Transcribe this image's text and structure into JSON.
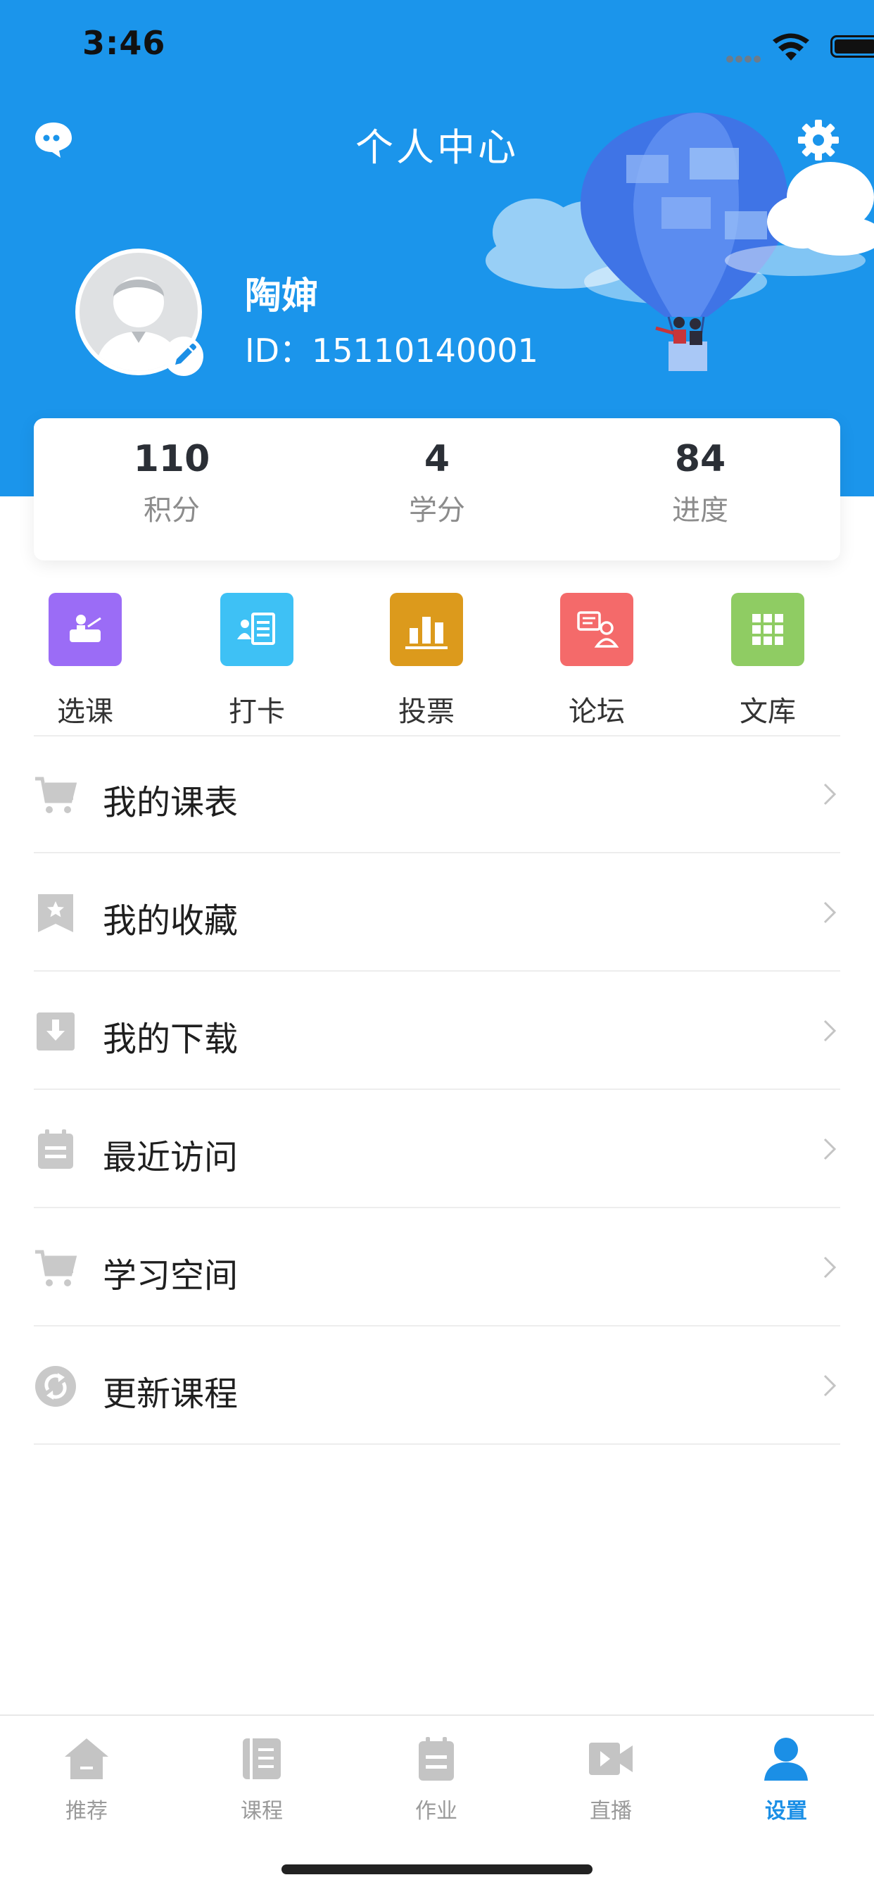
{
  "status_bar": {
    "time": "3:46"
  },
  "header": {
    "title": "个人中心"
  },
  "profile": {
    "name": "陶婶",
    "id_text": "ID：15110140001"
  },
  "stats": [
    {
      "value": "110",
      "label": "积分"
    },
    {
      "value": "4",
      "label": "学分"
    },
    {
      "value": "84",
      "label": "进度"
    }
  ],
  "quick_actions": [
    {
      "label": "选课",
      "icon": "course-select-icon",
      "color": "#9b6cf6"
    },
    {
      "label": "打卡",
      "icon": "checkin-icon",
      "color": "#3ec1f5"
    },
    {
      "label": "投票",
      "icon": "vote-icon",
      "color": "#dc9a1c"
    },
    {
      "label": "论坛",
      "icon": "forum-icon",
      "color": "#f46a6a"
    },
    {
      "label": "文库",
      "icon": "library-icon",
      "color": "#8fcc63"
    }
  ],
  "menu": [
    {
      "label": "我的课表",
      "icon": "cart-icon"
    },
    {
      "label": "我的收藏",
      "icon": "bookmark-star-icon"
    },
    {
      "label": "我的下载",
      "icon": "download-icon"
    },
    {
      "label": "最近访问",
      "icon": "calendar-icon"
    },
    {
      "label": "学习空间",
      "icon": "cart-icon"
    },
    {
      "label": "更新课程",
      "icon": "refresh-icon"
    }
  ],
  "tabs": [
    {
      "label": "推荐",
      "icon": "home-icon",
      "active": false
    },
    {
      "label": "课程",
      "icon": "book-icon",
      "active": false
    },
    {
      "label": "作业",
      "icon": "clipboard-icon",
      "active": false
    },
    {
      "label": "直播",
      "icon": "video-icon",
      "active": false
    },
    {
      "label": "设置",
      "icon": "person-icon",
      "active": true
    }
  ],
  "colors": {
    "header_bg": "#1b95eb",
    "accent": "#1b8fe6",
    "menu_icon": "#c9c9c9"
  }
}
